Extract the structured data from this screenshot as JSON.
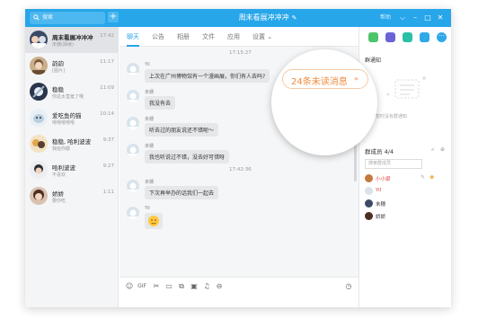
{
  "search": {
    "label": "搜索"
  },
  "window": {
    "title": "周末看展冲冲冲",
    "help": "帮助"
  },
  "conversations": [
    {
      "name": "周末看展冲冲冲",
      "msg": "未穗(顾绫)",
      "time": "17:42"
    },
    {
      "name": "韵韵",
      "msg": "[图片]",
      "time": "11:17"
    },
    {
      "name": "稳稳",
      "msg": "你这太害羞了哦",
      "time": "11:09"
    },
    {
      "name": "爱吃鱼的猫",
      "msg": "嘻嘻嘻嘻嘻",
      "time": "10:14"
    },
    {
      "name": "稳稳, 哈利波波",
      "msg": "我给你都",
      "time": "9:37"
    },
    {
      "name": "哈利波波",
      "msg": "不喜欢",
      "time": "9:27"
    },
    {
      "name": "娇娇",
      "msg": "要你吃",
      "time": "1:11"
    }
  ],
  "tabs": [
    "聊天",
    "公告",
    "相册",
    "文件",
    "应用",
    "设置"
  ],
  "messages": {
    "time1": "17:15:27",
    "m1": {
      "sender": "YiI",
      "text": "上次在广州博物馆有一个漫画展，你们有人去吗?"
    },
    "m2": {
      "sender": "未穗",
      "text": "我没有去"
    },
    "m3": {
      "sender": "未穗",
      "text": "听去过的朋友说还不错呢～"
    },
    "m4": {
      "sender": "未穗",
      "text": "我也听说过不错，没去好可惜呀"
    },
    "time2": "17:42:36",
    "m5": {
      "sender": "未穗",
      "text": "下次再举办的话我们一起去"
    },
    "m6": {
      "sender": "YiI"
    }
  },
  "unread": {
    "text": "24条未读消息",
    "chevron": "»"
  },
  "right_panel": {
    "notice_title": "群通知",
    "notice_empty": "暂时没有群通知",
    "members_title": "群成员 4/4",
    "members_search_placeholder": "搜索群成员",
    "members": [
      {
        "name": "小小梁",
        "color": "#e0403a"
      },
      {
        "name": "YiI",
        "color": "#e0403a"
      },
      {
        "name": "未穗",
        "color": "#333333"
      },
      {
        "name": "娇娇",
        "color": "#333333"
      }
    ]
  },
  "colors": {
    "accent": "#27a6ea",
    "unread": "#f08a3c"
  }
}
